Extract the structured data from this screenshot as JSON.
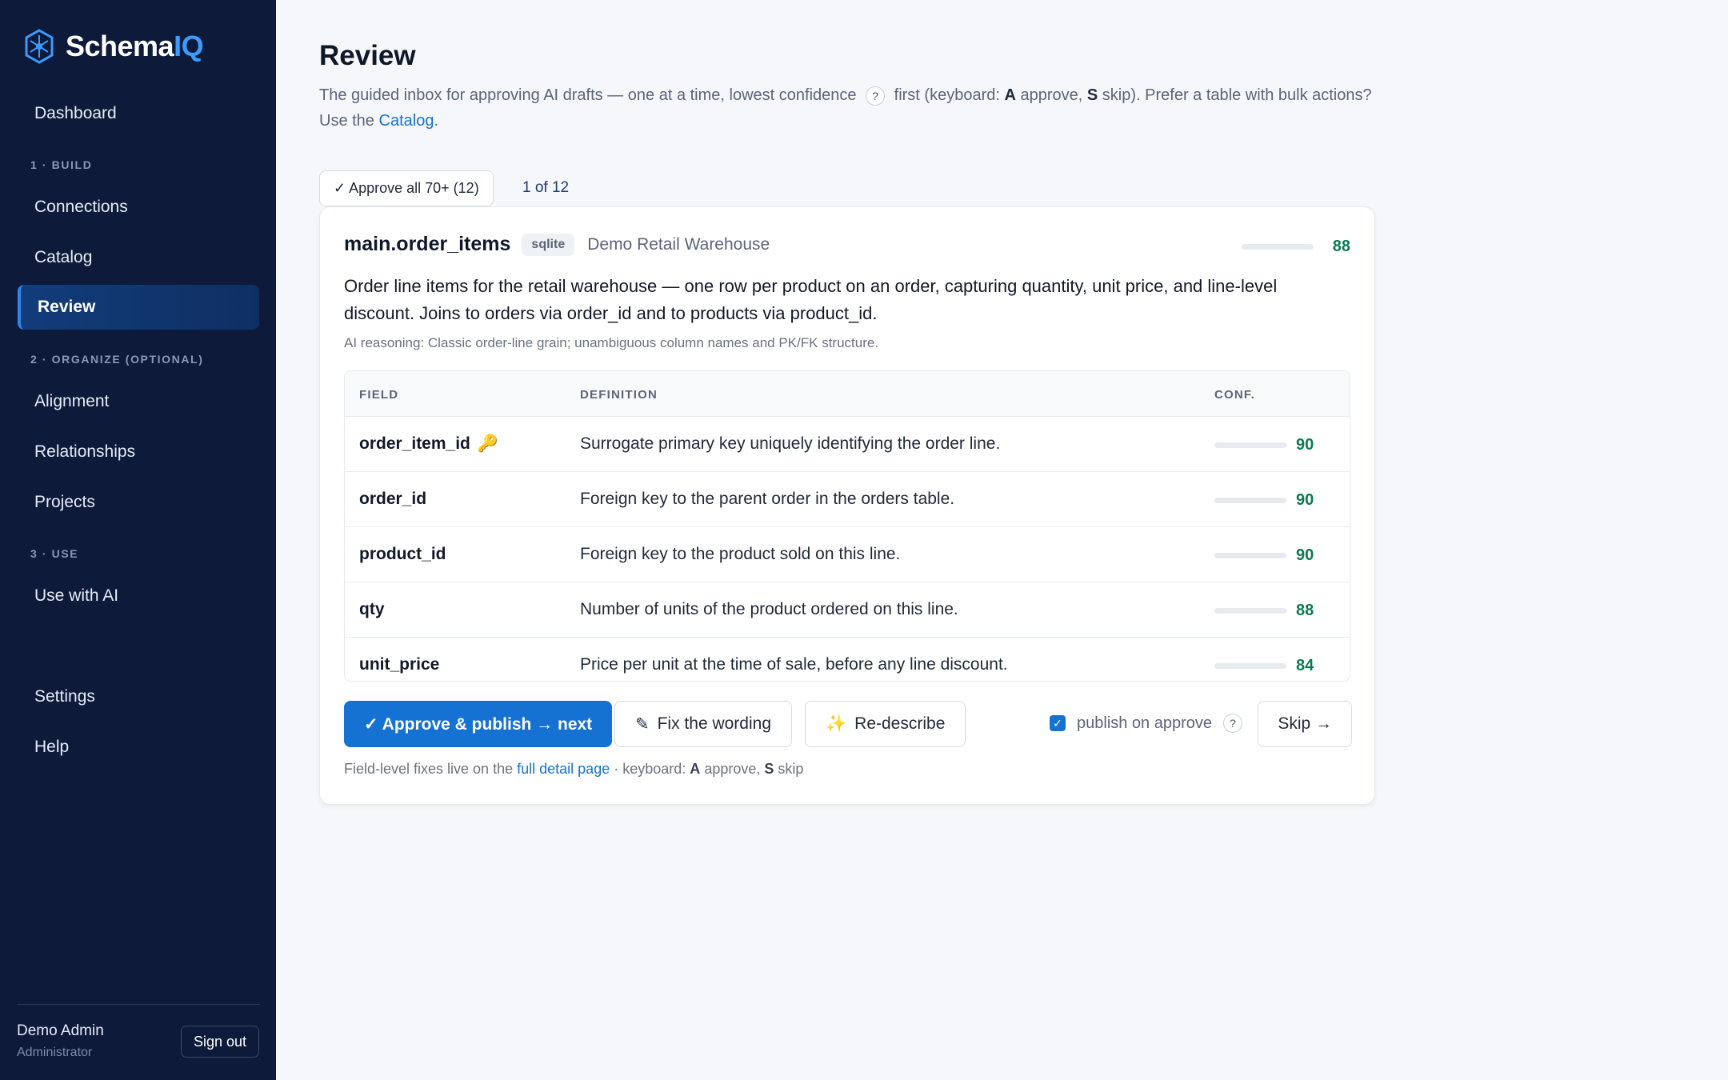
{
  "app": {
    "brand_main": "Schema",
    "brand_accent": "IQ"
  },
  "sidebar": {
    "items": [
      {
        "label": "Dashboard"
      },
      {
        "label": "Connections"
      },
      {
        "label": "Catalog"
      },
      {
        "label": "Review",
        "active": true
      },
      {
        "label": "Alignment"
      },
      {
        "label": "Relationships"
      },
      {
        "label": "Projects"
      },
      {
        "label": "Use with AI"
      },
      {
        "label": "Settings"
      },
      {
        "label": "Help"
      }
    ],
    "sections": [
      "1 · BUILD",
      "2 · ORGANIZE (OPTIONAL)",
      "3 · USE"
    ],
    "user": {
      "name": "Demo Admin",
      "role": "Administrator",
      "signout_label": "Sign out"
    }
  },
  "page": {
    "title": "Review",
    "desc_part1": "The guided inbox for approving AI drafts — one at a time, lowest confidence",
    "desc_help": "?",
    "desc_part2": "first (keyboard:",
    "desc_key_a": "A",
    "desc_part3": "approve,",
    "desc_key_s": "S",
    "desc_part4": "skip). Prefer a table with bulk actions? Use the",
    "desc_link": "Catalog",
    "desc_end": "."
  },
  "toolbar": {
    "approve_all_label": "✓ Approve all 70+ (12)",
    "counter": "1 of 12"
  },
  "card": {
    "table_name": "main.order_items",
    "engine": "sqlite",
    "source": "Demo Retail Warehouse",
    "confidence": 88,
    "description": "Order line items for the retail warehouse — one row per product on an order, capturing quantity, unit price, and line-level discount. Joins to orders via order_id and to products via product_id.",
    "ai_reasoning": "AI reasoning: Classic order-line grain; unambiguous column names and PK/FK structure.",
    "columns": {
      "field": "FIELD",
      "definition": "DEFINITION",
      "conf": "CONF."
    },
    "fields": [
      {
        "name": "order_item_id",
        "key_icon": "🔑",
        "definition": "Surrogate primary key uniquely identifying the order line.",
        "conf": 90
      },
      {
        "name": "order_id",
        "key_icon": "",
        "definition": "Foreign key to the parent order in the orders table.",
        "conf": 90
      },
      {
        "name": "product_id",
        "key_icon": "",
        "definition": "Foreign key to the product sold on this line.",
        "conf": 90
      },
      {
        "name": "qty",
        "key_icon": "",
        "definition": "Number of units of the product ordered on this line.",
        "conf": 88
      },
      {
        "name": "unit_price",
        "key_icon": "",
        "definition": "Price per unit at the time of sale, before any line discount.",
        "conf": 84
      }
    ],
    "actions": {
      "approve_label": "✓ Approve & publish → next",
      "fix_label": "Fix the wording",
      "fix_icon": "✎",
      "redescribe_label": "Re-describe",
      "redescribe_icon": "✨",
      "publish_label": "publish on approve",
      "publish_checked": true,
      "publish_help": "?",
      "skip_label": "Skip →"
    },
    "footnote_part1": "Field-level fixes live on the",
    "footnote_link": "full detail page",
    "footnote_part2": "· keyboard:",
    "footnote_key_a": "A",
    "footnote_part3": "approve,",
    "footnote_key_s": "S",
    "footnote_part4": "skip"
  },
  "colors": {
    "sidebar_bg": "#0e1a3a",
    "accent": "#1672d2",
    "confidence_green": "#0b7a53"
  }
}
